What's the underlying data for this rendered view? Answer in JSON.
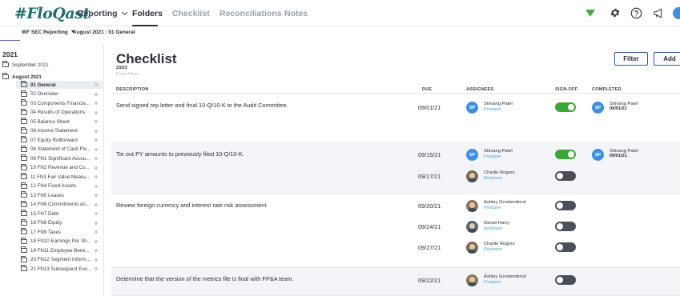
{
  "app": {
    "logo": "#FloQast"
  },
  "nav": {
    "reporting": "Reporting",
    "folders": "Folders",
    "checklist": "Checklist",
    "reconciliations": "Reconciliations",
    "notes": "Notes"
  },
  "subbar": {
    "dropdown": "WF SEC Reporting",
    "breadcrumb": "August 2021 : 01 General"
  },
  "sidebar": {
    "year": "2021",
    "september": "September 2021",
    "august": "August 2021",
    "items": [
      "01 General",
      "02 Overview",
      "03 Components Financia...",
      "04 Results of Operations",
      "05 Balance Sheet",
      "06 Income Statement",
      "07 Equity Rollforward",
      "08 Statement of Cash Flo...",
      "09 FN1 Significant Accou...",
      "10 FN2 Revenue and Co...",
      "11 FN3 Fair Value Measu...",
      "12 FN4 Fixed Assets",
      "13 FN5 Leases",
      "14 FN6 Commitments an...",
      "15 FN7 Debt",
      "16 FN8 Equity",
      "17 FN9 Taxes",
      "18 FN10 Earnings Per Sh...",
      "19 FN11 Employee Bene...",
      "20 FN12 Segment Inform...",
      "21 FN13 Subsequent Eve..."
    ]
  },
  "main": {
    "title": "Checklist",
    "count": "23/23",
    "reset": "Reset Filters",
    "filter_button": "Filter",
    "add_button": "Add",
    "columns": {
      "description": "DESCRIPTION",
      "due": "DUE",
      "assignees": "ASSIGNEES",
      "signoff": "SIGN-OFF",
      "completed": "COMPLETED"
    },
    "rows": [
      {
        "description": "Send signed rep letter and final 10-Q/10-K to the Audit Committee.",
        "assignments": [
          {
            "due": "09/01/21",
            "name": "Shivang Patel",
            "role": "Preparer",
            "initials": "SP",
            "signed": true,
            "completed_name": "Shivang Patel",
            "completed_date": "09/01/21",
            "completed_initials": "SP"
          }
        ]
      },
      {
        "description": "Tie out PY amounts to previously filed 10-Q/10-K.",
        "assignments": [
          {
            "due": "09/15/21",
            "name": "Shivang Patel",
            "role": "Preparer",
            "initials": "SP",
            "signed": true,
            "completed_name": "Shivang Patel",
            "completed_date": "09/01/21",
            "completed_initials": "SP"
          },
          {
            "due": "09/17/21",
            "name": "Charlie Rogers",
            "role": "Reviewer",
            "signed": false
          }
        ]
      },
      {
        "description": "Review foreign currency and interest rate risk assessment.",
        "assignments": [
          {
            "due": "09/20/21",
            "name": "Ashley Grootendorst",
            "role": "Preparer",
            "signed": false
          },
          {
            "due": "09/24/21",
            "name": "Daniel Harry",
            "role": "Reviewer",
            "signed": false
          },
          {
            "due": "09/27/21",
            "name": "Charlie Rogers",
            "role": "Reviewer",
            "signed": false
          }
        ]
      },
      {
        "description": "Determine that the version of the metrics file is final with FP&A team.",
        "assignments": [
          {
            "due": "09/22/21",
            "name": "Ashley Grootendorst",
            "role": "Preparer",
            "signed": false
          }
        ]
      }
    ]
  },
  "colors": {
    "accent": "#3c4fa0",
    "toggle_on": "#3aa838",
    "toggle_off": "#4a4f5a",
    "role": "#4aa4d8",
    "avatar": "#3f8fe0"
  }
}
